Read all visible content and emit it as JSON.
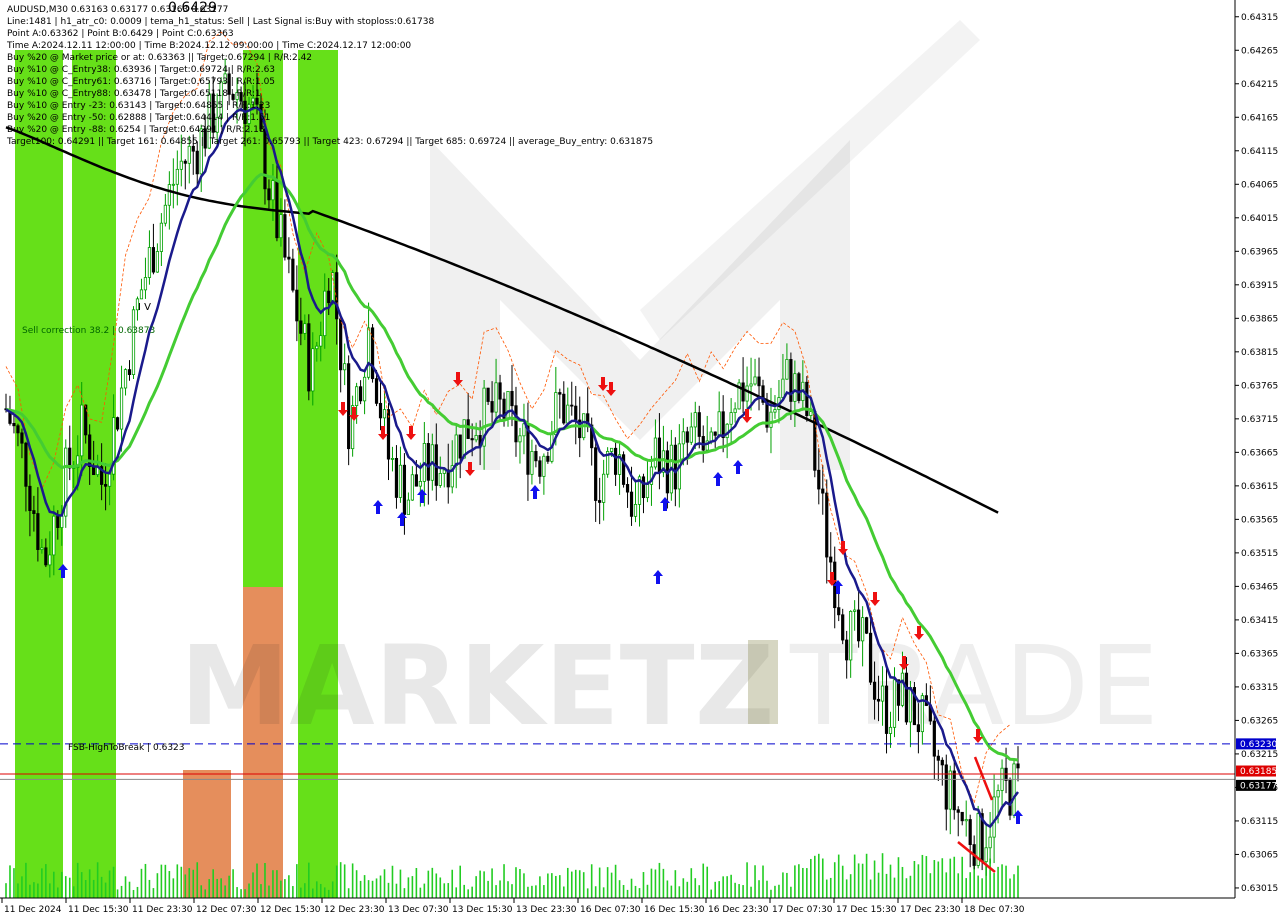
{
  "header": {
    "lines": [
      "AUDUSD,M30  0.63163 0.63177 0.63163 0.63177",
      "Line:1481 | h1_atr_c0: 0.0009 | tema_h1_status: Sell | Last Signal is:Buy with stoploss:0.61738",
      "Point A:0.63362 | Point B:0.6429 | Point C:0.63363",
      "Time A:2024.12.11 12:00:00 | Time B:2024.12.12 09:00:00 | Time C:2024.12.17 12:00:00",
      "Buy %20 @ Market price or at: 0.63363 || Target:0.67294 | R/R:2.42",
      "Buy %10 @ C_Entry38: 0.63936 | Target:0.69724 | R/R:2.63",
      "Buy %10 @ C_Entry61: 0.63716 | Target:0.65793 | R/R:1.05",
      "Buy %10 @ C_Entry88: 0.63478 | Target:0.65118 | R/R:1",
      "Buy %10 @ Entry -23: 0.63143 | Target:0.64855 | R/R:1.23",
      "Buy %20 @ Entry -50: 0.62888 | Target:0.64414 | R/R:1.51",
      "Buy %20 @ Entry -88: 0.6254 | Target:0.64291 | R/R:2.18",
      "Target100: 0.64291 || Target 161: 0.64855 || Target 261: 0.65793 || Target 423: 0.67294 || Target 685: 0.69724 || average_Buy_entry: 0.631875"
    ],
    "top_value": "0.6429"
  },
  "annotations": {
    "sell_correction": "Sell correction 38.2 | 0.63873",
    "fsb_label": "FSB-HighToBreak | 0.6323",
    "iv_label": "I V"
  },
  "watermark": {
    "part1": "MARKETZ",
    "part2": "TRADE"
  },
  "price_tags": {
    "fsb": "0.63230",
    "red": "0.63185",
    "current": "0.63177"
  },
  "colors": {
    "bull": "#00a000",
    "bear": "#000000",
    "ma_black": "#000000",
    "ma_blue": "#1a1a8c",
    "ma_green": "#44cc33",
    "fsb_line": "#0000cc",
    "red_line": "#dd0000",
    "green_zone": "#55dd00",
    "orange_zone": "#e07a40",
    "arrow_up": "#1010ee",
    "arrow_down": "#ee1010"
  },
  "chart_data": {
    "type": "candlestick",
    "symbol": "AUDUSD",
    "timeframe": "M30",
    "ylim": [
      0.63,
      0.6434
    ],
    "y_ticks": [
      0.63015,
      0.63065,
      0.63115,
      0.63165,
      0.63215,
      0.63265,
      0.63315,
      0.63365,
      0.63415,
      0.63465,
      0.63515,
      0.63565,
      0.63615,
      0.63665,
      0.63715,
      0.63765,
      0.63815,
      0.63865,
      0.63915,
      0.63965,
      0.64015,
      0.64065,
      0.64115,
      0.64165,
      0.64215,
      0.64265,
      0.64315
    ],
    "x_labels": [
      "11 Dec 2024",
      "11 Dec 15:30",
      "11 Dec 23:30",
      "12 Dec 07:30",
      "12 Dec 15:30",
      "12 Dec 23:30",
      "13 Dec 07:30",
      "13 Dec 15:30",
      "13 Dec 23:30",
      "16 Dec 07:30",
      "16 Dec 15:30",
      "16 Dec 23:30",
      "17 Dec 07:30",
      "17 Dec 15:30",
      "17 Dec 23:30",
      "18 Dec 07:30"
    ],
    "levels": {
      "fsb_high_to_break": 0.6323,
      "red_line": 0.63185,
      "current": 0.63177
    },
    "close_path": [
      0.6373,
      0.6365,
      0.635,
      0.6362,
      0.637,
      0.6362,
      0.6375,
      0.639,
      0.64,
      0.6409,
      0.6412,
      0.6418,
      0.6421,
      0.6417,
      0.6403,
      0.639,
      0.6378,
      0.6395,
      0.637,
      0.6385,
      0.6366,
      0.636,
      0.6364,
      0.6365,
      0.637,
      0.6372,
      0.6373,
      0.6368,
      0.6366,
      0.6374,
      0.637,
      0.6362,
      0.6367,
      0.6357,
      0.6366,
      0.6364,
      0.6369,
      0.6365,
      0.6375,
      0.6377,
      0.6372,
      0.6378,
      0.6372,
      0.6353,
      0.634,
      0.6337,
      0.6328,
      0.633,
      0.6326,
      0.6318,
      0.6312,
      0.6308,
      0.6315,
      0.6317
    ]
  }
}
